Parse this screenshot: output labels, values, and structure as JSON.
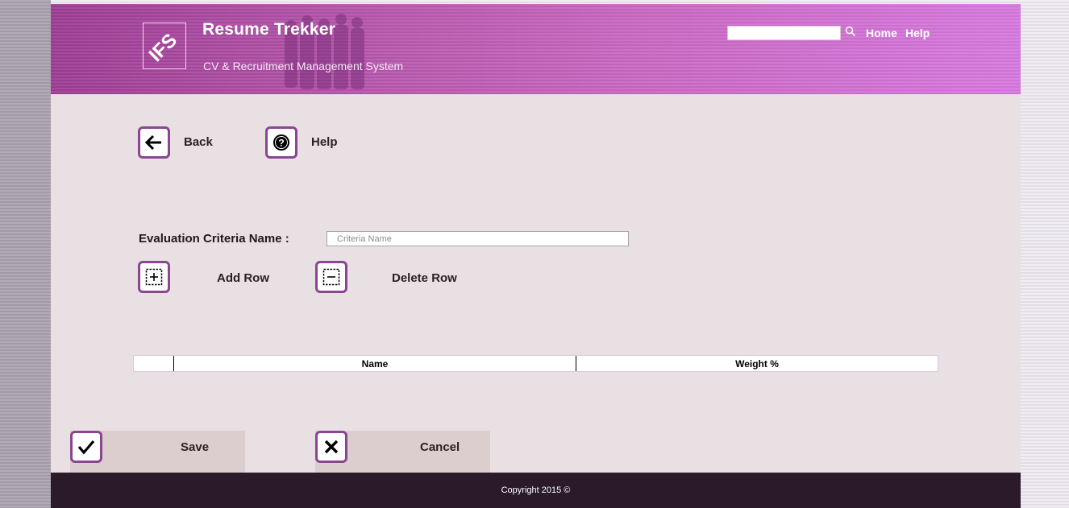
{
  "header": {
    "logo_text": "IFS",
    "title": "Resume Trekker",
    "subtitle": "CV & Recruitment Management System",
    "search": {
      "value": "",
      "placeholder": ""
    },
    "nav": {
      "home": "Home",
      "help": "Help"
    }
  },
  "toolbar": {
    "back_label": "Back",
    "help_label": "Help"
  },
  "form": {
    "criteria_label": "Evaluation Criteria Name :",
    "criteria_placeholder": "Criteria Name",
    "criteria_value": "",
    "add_row_label": "Add Row",
    "delete_row_label": "Delete Row"
  },
  "grid": {
    "columns": [
      "",
      "Name",
      "Weight %"
    ],
    "rows": []
  },
  "actions": {
    "save_label": "Save",
    "cancel_label": "Cancel"
  },
  "footer": {
    "copyright": "Copyright 2015 ©"
  },
  "colors": {
    "header_start": "#9e3d95",
    "header_end": "#d779df",
    "icon_border": "#8a4690",
    "page_bg": "#e8e0e2",
    "footer_bg": "#2a1a2a"
  },
  "icons": {
    "back": "arrow-left-icon",
    "help": "question-circle-icon",
    "add_row": "plus-box-icon",
    "delete_row": "minus-box-icon",
    "save": "checkmark-icon",
    "cancel": "x-icon",
    "search": "search-icon"
  }
}
